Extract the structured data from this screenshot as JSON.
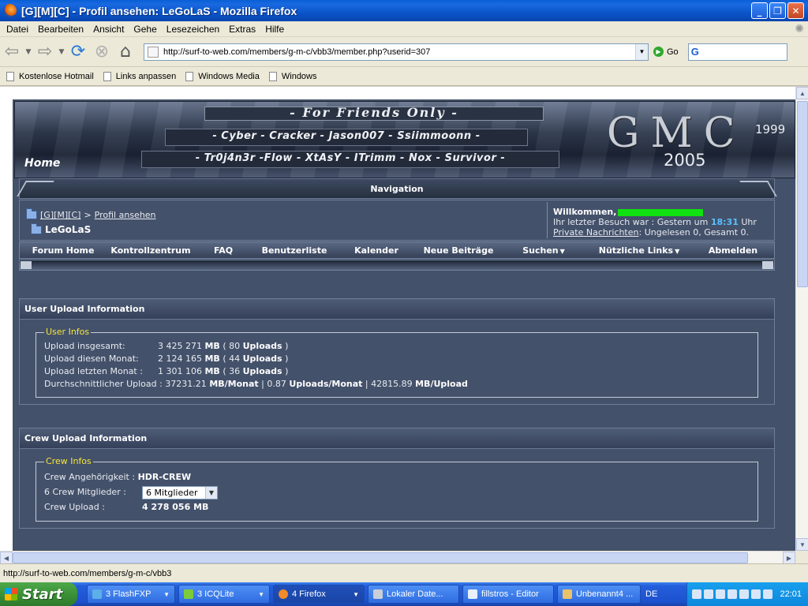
{
  "window": {
    "title": "[G][M][C] - Profil ansehen: LeGoLaS - Mozilla Firefox",
    "minimize": "_",
    "maximize": "❐",
    "close": "✕"
  },
  "menu": [
    "Datei",
    "Bearbeiten",
    "Ansicht",
    "Gehe",
    "Lesezeichen",
    "Extras",
    "Hilfe"
  ],
  "toolbar": {
    "url": "http://surf-to-web.com/members/g-m-c/vbb3/member.php?userid=307",
    "go_label": "Go",
    "search_engine_glyph": "G"
  },
  "bookmarks": [
    "Kostenlose Hotmail",
    "Links anpassen",
    "Windows Media",
    "Windows"
  ],
  "banner": {
    "tagline": "- For Friends Only -",
    "names_row1": "- Cyber - Cracker - Jason007 - Ssiimmoonn -",
    "names_row2": "- Tr0j4n3r -Flow - XtAsY - ITrimm - Nox - Survivor -",
    "home": "Home",
    "logo": "GMC",
    "year_from": "1999",
    "year_to": "2005"
  },
  "navigation_title": "Navigation",
  "breadcrumb": {
    "root": "[G][M][C]",
    "separator": ">",
    "current_link": "Profil ansehen",
    "page": "LeGoLaS"
  },
  "welcome": {
    "greeting": "Willkommen,",
    "last_visit_prefix": "Ihr letzter Besuch war : Gestern um",
    "last_visit_time": "18:31",
    "last_visit_suffix": "Uhr",
    "pm_link": "Private Nachrichten",
    "pm_status": ": Ungelesen 0, Gesamt 0."
  },
  "links": [
    "Forum Home",
    "Kontrollzentrum",
    "FAQ",
    "Benutzerliste",
    "Kalender",
    "Neue Beiträge",
    "Suchen",
    "Nützliche Links",
    "Abmelden"
  ],
  "user_upload": {
    "heading": "User Upload Information",
    "legend": "User Infos",
    "total_label": "Upload insgesamt:",
    "total_mb": "3 425 271",
    "total_uploads": "80",
    "month_label": "Upload diesen Monat:",
    "month_mb": "2 124 165",
    "month_uploads": "44",
    "last_label": "Upload letzten Monat :",
    "last_mb": "1 301 106",
    "last_uploads": "36",
    "avg_label": "Durchschnittlicher Upload :",
    "avg_mb_month": "37231.21",
    "avg_uploads_month": "0.87",
    "avg_mb_upload": "42815.89",
    "unit_mb": "MB",
    "unit_uploads": "Uploads",
    "unit_mb_month": "MB/Monat",
    "unit_uploads_month": "Uploads/Monat",
    "unit_mb_upload": "MB/Upload"
  },
  "crew_upload": {
    "heading": "Crew Upload Information",
    "legend": "Crew Infos",
    "membership_label": "Crew Angehörigkeit :",
    "membership": "HDR-CREW",
    "members_label": "6 Crew Mitglieder :",
    "members_select": "6 Mitglieder",
    "upload_label": "Crew Upload :",
    "upload_value": "4 278 056 MB"
  },
  "status": "http://surf-to-web.com/members/g-m-c/vbb3",
  "taskbar": {
    "start": "Start",
    "items": [
      "3 FlashFXP",
      "3 ICQLite",
      "4 Firefox",
      "Lokaler Date...",
      "fillstros - Editor",
      "Unbenannt4 ..."
    ],
    "lang": "DE",
    "clock": "22:01"
  }
}
